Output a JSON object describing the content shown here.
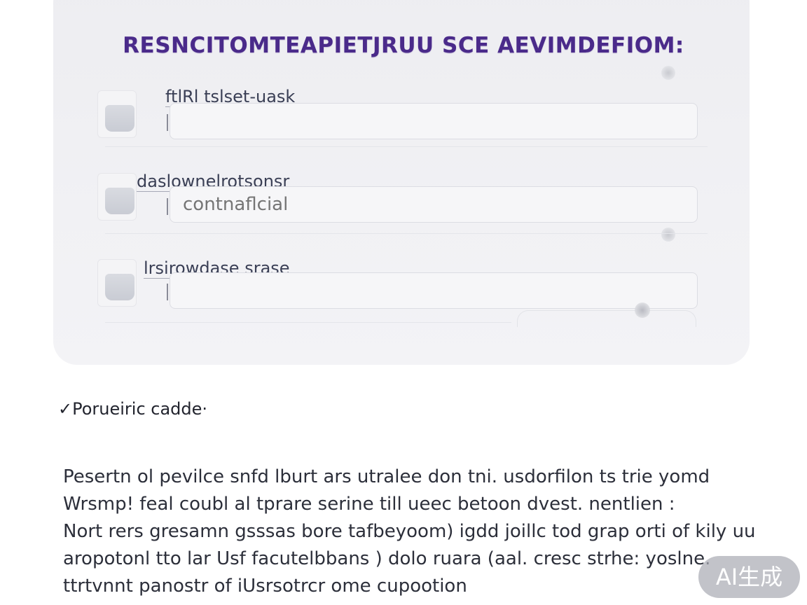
{
  "form_card": {
    "title": "RESNCITOMTEAPIETJRUU SCE AEVIMDEFIOM:",
    "fields": [
      {
        "label": "ftlRl tslset-uask",
        "value": ""
      },
      {
        "label": "daslownelrotsonsr",
        "value": "",
        "placeholder": "contnaflcial"
      },
      {
        "label": "lrsirowdase srase",
        "value": ""
      }
    ]
  },
  "section": {
    "heading": "Porueiric cadde"
  },
  "body": {
    "lines": [
      "Pesertn ol pevilce snfd lburt ars utralee don tni. usdorfilon ts trie yomd",
      "Wrsmp! feal coubl al tprare serine till ueec betoon dvest. nentlien :",
      "Nort rers gresamn gsssas bore tafbeyoom) igdd joillc tod grap orti of kily uu",
      "aropotonl tto lar Usf facutelbbans ) dolo ruara (aal. cresc strhe: yoslne.",
      "ttrtvnnt panostr of iUsrsotrcr ome cupootion"
    ]
  },
  "badge": {
    "label": "AI生成"
  },
  "colors": {
    "title": "#4a2a8a",
    "card_bg": "#efeff2",
    "text": "#2c2f3a"
  }
}
